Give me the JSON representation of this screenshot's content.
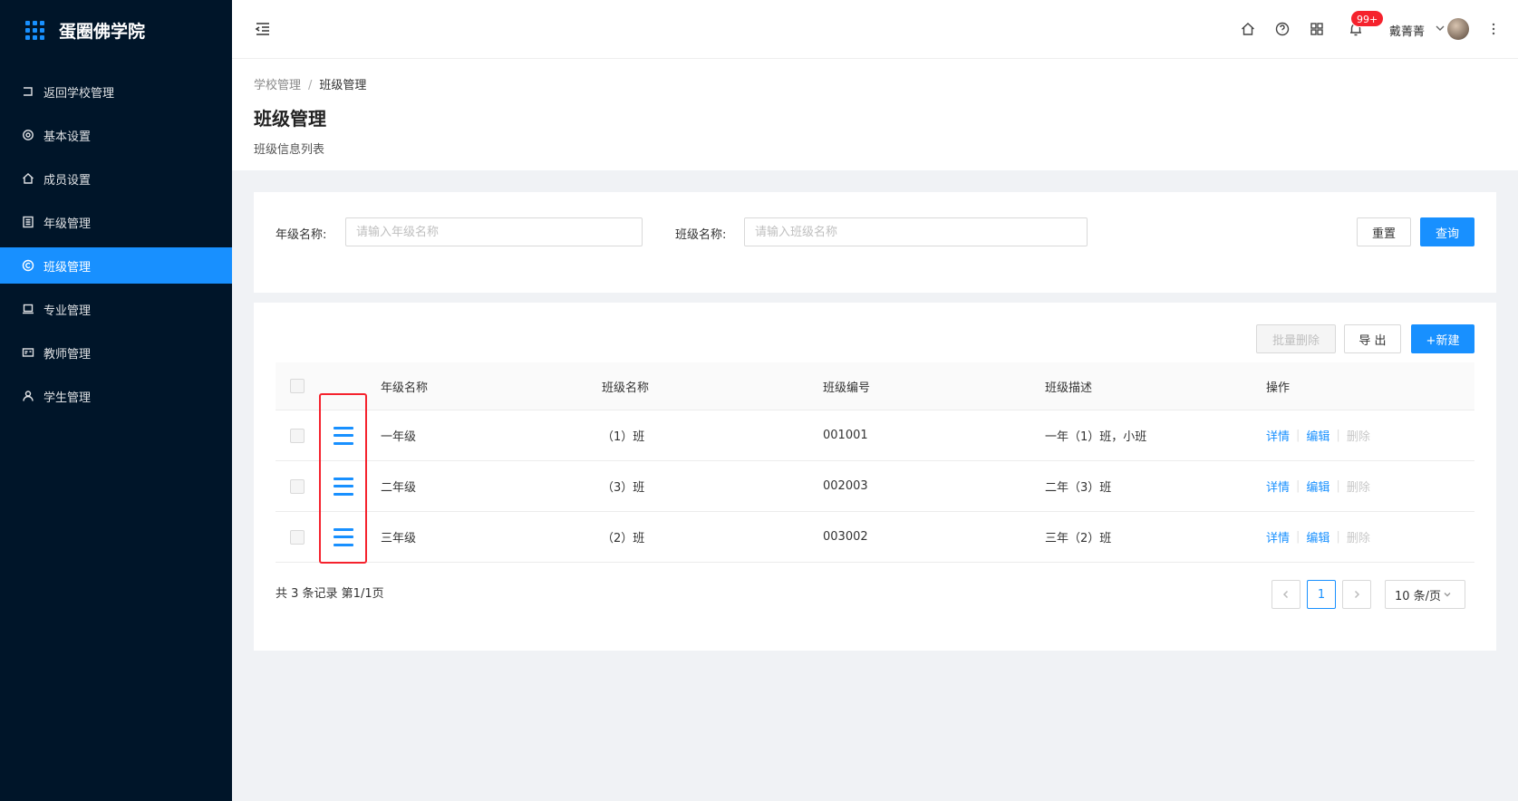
{
  "app": {
    "title": "蛋圈佛学院"
  },
  "sidebar": {
    "items": [
      {
        "label": "返回学校管理",
        "icon": "return-icon",
        "active": false
      },
      {
        "label": "基本设置",
        "icon": "gear-icon",
        "active": false
      },
      {
        "label": "成员设置",
        "icon": "home-icon",
        "active": false
      },
      {
        "label": "年级管理",
        "icon": "book-icon",
        "active": false
      },
      {
        "label": "班级管理",
        "icon": "copyright-icon",
        "active": true
      },
      {
        "label": "专业管理",
        "icon": "laptop-icon",
        "active": false
      },
      {
        "label": "教师管理",
        "icon": "idcard-icon",
        "active": false
      },
      {
        "label": "学生管理",
        "icon": "user-icon",
        "active": false
      }
    ]
  },
  "header": {
    "notification_count": "99+",
    "username": "戴菁菁"
  },
  "breadcrumb": {
    "parent": "学校管理",
    "separator": "/",
    "current": "班级管理"
  },
  "page": {
    "title": "班级管理",
    "subtitle": "班级信息列表"
  },
  "search": {
    "grade_label": "年级名称:",
    "grade_placeholder": "请输入年级名称",
    "grade_value": "",
    "class_label": "班级名称:",
    "class_placeholder": "请输入班级名称",
    "class_value": "",
    "reset_label": "重置",
    "query_label": "查询"
  },
  "toolbar": {
    "batch_delete_label": "批量删除",
    "export_label": "导 出",
    "new_label": "+新建"
  },
  "table": {
    "columns": [
      "年级名称",
      "班级名称",
      "班级编号",
      "班级描述",
      "操作"
    ],
    "rows": [
      {
        "grade": "一年级",
        "class": "（1）班",
        "code": "001001",
        "desc": "一年（1）班，小班"
      },
      {
        "grade": "二年级",
        "class": "（3）班",
        "code": "002003",
        "desc": "二年（3）班"
      },
      {
        "grade": "三年级",
        "class": "（2）班",
        "code": "003002",
        "desc": "三年（2）班"
      }
    ],
    "actions": {
      "detail": "详情",
      "edit": "编辑",
      "delete": "删除"
    }
  },
  "pagination": {
    "total_text": "共 3 条记录 第1/1页",
    "current_page": "1",
    "page_size": "10 条/页"
  },
  "colors": {
    "primary": "#1890ff",
    "sidebar_bg": "#001529",
    "highlight": "#f5222d"
  }
}
